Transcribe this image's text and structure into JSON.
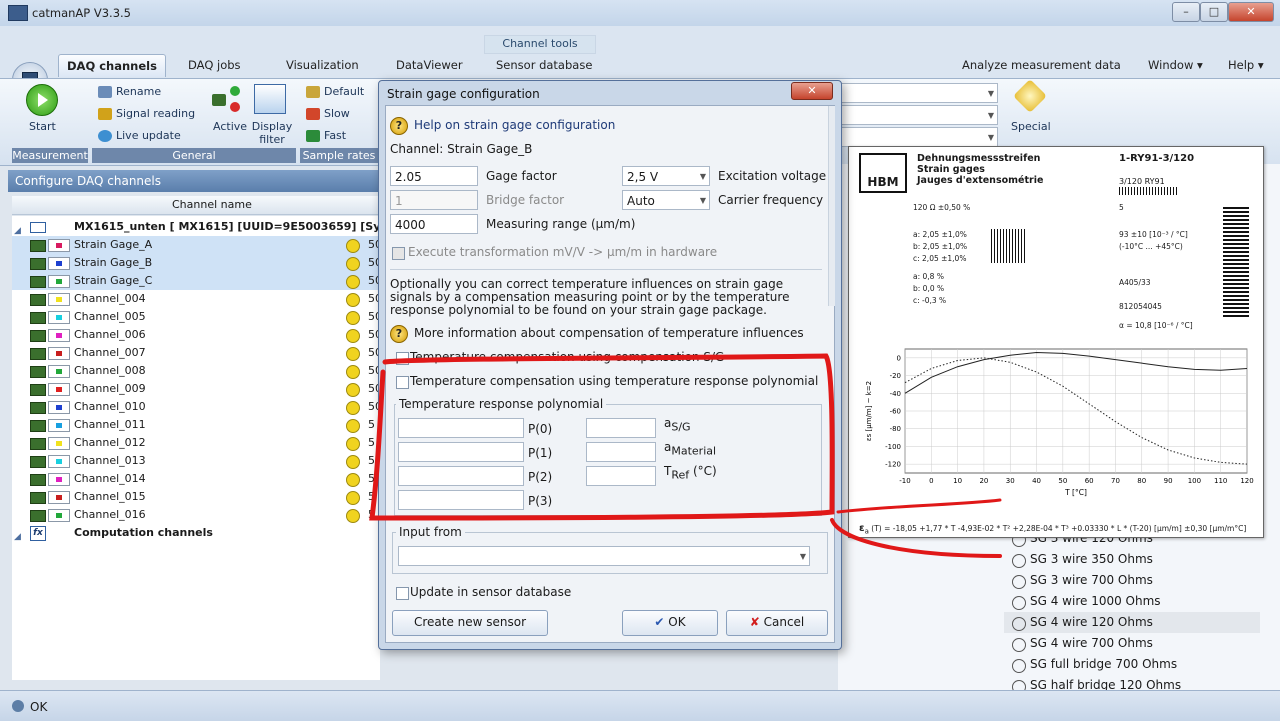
{
  "window": {
    "title": "catmanAP V3.3.5"
  },
  "ribbon": {
    "context_label": "Channel tools",
    "tabs": [
      "DAQ channels",
      "DAQ jobs",
      "Visualization",
      "DataViewer",
      "Sensor database"
    ],
    "right_items": [
      "Analyze measurement data",
      "Window",
      "Help"
    ],
    "groups": {
      "measurement": "Measurement",
      "general": "General",
      "sample_rates": "Sample rates"
    },
    "start": "Start",
    "rename": "Rename",
    "signal_reading": "Signal reading",
    "live_update": "Live update",
    "active": "Active",
    "display_filter": "Display filter",
    "rate_default": "Default",
    "rate_slow": "Slow",
    "rate_fast": "Fast",
    "special": "Special"
  },
  "channels_panel": {
    "header": "Configure DAQ channels",
    "column": "Channel name",
    "device": "MX1615_unten   [ MX1615] [UUID=9E5003659] [Sync-Single",
    "rows": [
      {
        "name": "Strain Gage_A",
        "color": "#d81b60",
        "val": "50"
      },
      {
        "name": "Strain Gage_B",
        "color": "#1e40d0",
        "val": "50"
      },
      {
        "name": "Strain Gage_C",
        "color": "#22a83a",
        "val": "50"
      },
      {
        "name": "Channel_004",
        "color": "#f1e21d",
        "val": "50"
      },
      {
        "name": "Channel_005",
        "color": "#18d0e0",
        "val": "50"
      },
      {
        "name": "Channel_006",
        "color": "#e020c0",
        "val": "50"
      },
      {
        "name": "Channel_007",
        "color": "#c81e1e",
        "val": "50"
      },
      {
        "name": "Channel_008",
        "color": "#22a83a",
        "val": "50"
      },
      {
        "name": "Channel_009",
        "color": "#e02020",
        "val": "50"
      },
      {
        "name": "Channel_010",
        "color": "#1e40d0",
        "val": "50"
      },
      {
        "name": "Channel_011",
        "color": "#18a0e0",
        "val": "5"
      },
      {
        "name": "Channel_012",
        "color": "#f1e21d",
        "val": "5"
      },
      {
        "name": "Channel_013",
        "color": "#18d0e0",
        "val": "5"
      },
      {
        "name": "Channel_014",
        "color": "#e020c0",
        "val": "5"
      },
      {
        "name": "Channel_015",
        "color": "#c81e1e",
        "val": "5"
      },
      {
        "name": "Channel_016",
        "color": "#22a83a",
        "val": "5"
      }
    ],
    "computation": "Computation channels"
  },
  "status": {
    "text": "OK"
  },
  "sensor_list": [
    "SG 3 wire 120 Ohms",
    "SG 3 wire 350 Ohms",
    "SG 3 wire 700 Ohms",
    "SG 4 wire 1000 Ohms",
    "SG 4 wire 120 Ohms",
    "SG 4 wire 700 Ohms",
    "SG full bridge 700 Ohms",
    "SG half bridge 120 Ohms"
  ],
  "dialog": {
    "title": "Strain gage configuration",
    "help_link": "Help on strain gage configuration",
    "channel": "Channel: Strain Gage_B",
    "gage_factor_value": "2.05",
    "gage_factor_label": "Gage factor",
    "bridge_factor_value": "1",
    "bridge_factor_label": "Bridge factor",
    "range_value": "4000",
    "range_label": "Measuring range (µm/m)",
    "excitation_value": "2,5 V",
    "excitation_label": "Excitation voltage",
    "carrier_value": "Auto",
    "carrier_label": "Carrier frequency",
    "execute_label": "Execute transformation mV/V -> µm/m in hardware",
    "info_text": "Optionally you can correct temperature influences on strain gage signals by a compensation measuring point or by the temperature response polynomial to be found on your strain gage package.",
    "more_info_link": "More information about compensation of temperature influences",
    "comp_sg_label": "Temperature compensation using compensation S/G",
    "comp_poly_label": "Temperature compensation using temperature response polynomial",
    "poly_group": "Temperature response polynomial",
    "p_labels": [
      "P(0)",
      "P(1)",
      "P(2)",
      "P(3)"
    ],
    "a_sg": "a",
    "a_sg_sub": "S/G",
    "a_mat": "a",
    "a_mat_sub": "Material",
    "t_ref": "T",
    "t_ref_sub": "Ref",
    "t_ref_unit": "(°C)",
    "input_from_label": "Input from",
    "update_db_label": "Update in sensor database",
    "create_btn": "Create new sensor",
    "ok_btn": "OK",
    "cancel_btn": "Cancel"
  },
  "hbm_label": {
    "brand": "HBM",
    "title_de": "Dehnungsmessstreifen",
    "title_en": "Strain gages",
    "title_fr": "Jauges d'extensométrie",
    "order_no": "1-RY91-3/120",
    "type": "3/120 RY91",
    "resistance": "120 Ω  ±0,50 %",
    "quantity": "5",
    "k_a": "a: 2,05  ±1,0%",
    "k_b": "b: 2,05  ±1,0%",
    "k_c": "c: 2,05  ±1,0%",
    "tk": "93 ±10 [10⁻³ / °C]",
    "temp_range": "(-10°C ... +45°C)",
    "q_a": "a:  0,8 %",
    "q_b": "b:  0,0 %",
    "q_c": "c:  -0,3 %",
    "lot": "A405/33",
    "batch": "812054045",
    "alpha": "α = 10,8 [10⁻⁶ / °C]",
    "formula": "(T) = -18,05 +1,77 * T -4,93E-02 * T² +2,28E-04 * T³ +0.03330 * L * (T-20) [µm/m] ±0,30 [µm/m°C]",
    "formula_sym": "ε",
    "formula_sub": "a"
  },
  "chart_data": {
    "type": "line",
    "xlabel": "T [°C]",
    "ylabel": "εs [µm/m] ~ k=2",
    "xlim": [
      -10,
      120
    ],
    "ylim": [
      -130,
      10
    ],
    "xticks": [
      -10,
      0,
      10,
      20,
      30,
      40,
      50,
      60,
      70,
      80,
      90,
      100,
      110,
      120
    ],
    "yticks": [
      0,
      -20,
      -40,
      -60,
      -80,
      -100,
      -120
    ],
    "series": [
      {
        "style": "solid",
        "x": [
          -10,
          0,
          10,
          20,
          30,
          40,
          50,
          60,
          70,
          80,
          90,
          100,
          110,
          120
        ],
        "y": [
          -40,
          -22,
          -10,
          -2,
          3,
          6,
          5,
          2,
          -2,
          -6,
          -10,
          -13,
          -14,
          -12
        ]
      },
      {
        "style": "dotted",
        "x": [
          -10,
          0,
          10,
          20,
          30,
          40,
          50,
          60,
          70,
          80,
          90,
          100,
          110,
          120
        ],
        "y": [
          -28,
          -12,
          -3,
          0,
          -5,
          -16,
          -32,
          -52,
          -72,
          -90,
          -104,
          -113,
          -118,
          -120
        ]
      }
    ]
  },
  "colors": {
    "annotation": "#e01818",
    "accent": "#5a7eab"
  }
}
